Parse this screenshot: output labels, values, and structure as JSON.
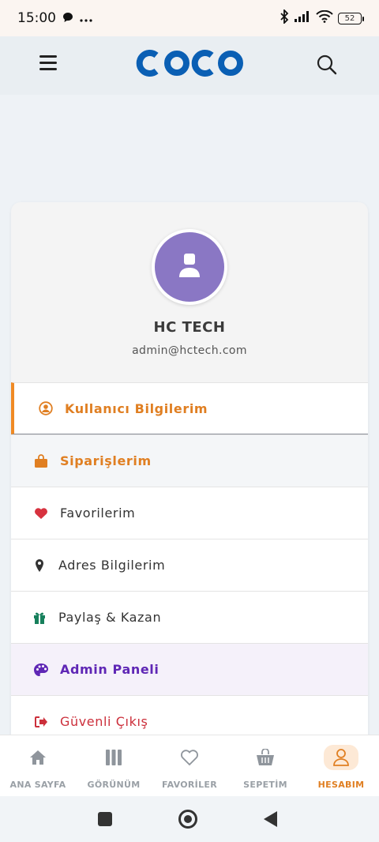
{
  "status_bar": {
    "time": "15:00",
    "battery": "52",
    "icons": [
      "chat-bubble-icon",
      "more-dots-icon",
      "bluetooth-icon",
      "signal-icon",
      "wifi-icon",
      "battery-icon"
    ]
  },
  "header": {
    "logo_text": "COCO",
    "menu_icon": "hamburger-icon",
    "search_icon": "search-icon"
  },
  "profile": {
    "name": "HC TECH",
    "email": "admin@hctech.com",
    "avatar_icon": "user-icon"
  },
  "menu": [
    {
      "label": "Kullanıcı Bilgilerim",
      "icon": "user-circle-icon"
    },
    {
      "label": "Siparişlerim",
      "icon": "shopping-bag-icon"
    },
    {
      "label": "Favorilerim",
      "icon": "heart-icon"
    },
    {
      "label": "Adres Bilgilerim",
      "icon": "map-pin-icon"
    },
    {
      "label": "Paylaş & Kazan",
      "icon": "gift-icon"
    },
    {
      "label": "Admin Paneli",
      "icon": "palette-icon"
    },
    {
      "label": "Güvenli Çıkış",
      "icon": "sign-out-icon"
    }
  ],
  "bottom_nav": [
    {
      "label": "ANA SAYFA",
      "icon": "home-icon"
    },
    {
      "label": "GÖRÜNÜM",
      "icon": "columns-icon"
    },
    {
      "label": "FAVORİLER",
      "icon": "heart-outline-icon"
    },
    {
      "label": "SEPETİM",
      "icon": "basket-icon"
    },
    {
      "label": "HESABIM",
      "icon": "user-outline-icon",
      "active": true
    }
  ],
  "colors": {
    "brand_blue": "#0a5fb4",
    "accent_orange": "#e07f22",
    "admin_purple": "#5f27b5",
    "logout_red": "#cc2f3b",
    "avatar_purple": "#8a77c4"
  }
}
